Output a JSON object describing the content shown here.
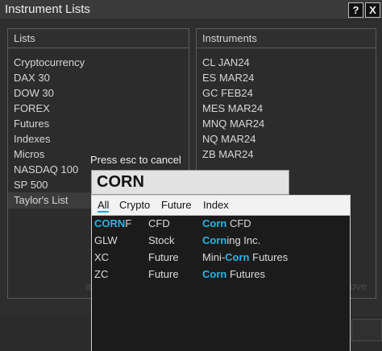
{
  "window": {
    "title": "Instrument Lists",
    "help_label": "?",
    "close_label": "X"
  },
  "lists_panel": {
    "header": "Lists",
    "items": [
      "Cryptocurrency",
      "DAX 30",
      "DOW 30",
      "FOREX",
      "Futures",
      "Indexes",
      "Micros",
      "NASDAQ 100",
      "SP 500",
      "Taylor's List"
    ],
    "selected_item": "Taylor's List"
  },
  "instruments_panel": {
    "header": "Instruments",
    "items": [
      "CL JAN24",
      "ES MAR24",
      "GC FEB24",
      "MES MAR24",
      "MNQ MAR24",
      "NQ MAR24",
      "ZB MAR24"
    ]
  },
  "background_fragments": {
    "left": "a",
    "right": "ove"
  },
  "search": {
    "prompt": "Press esc to cancel",
    "value": "CORN"
  },
  "filter_tabs": [
    {
      "label": "All",
      "active": true
    },
    {
      "label": "Crypto",
      "active": false
    },
    {
      "label": "Future",
      "active": false
    },
    {
      "label": "Index",
      "active": false
    }
  ],
  "results": [
    {
      "symbol_match": "CORN",
      "symbol_rest": "F",
      "type": "CFD",
      "desc_pre": "",
      "desc_match": "Corn",
      "desc_post": " CFD"
    },
    {
      "symbol_match": "",
      "symbol_rest": "GLW",
      "type": "Stock",
      "desc_pre": "",
      "desc_match": "Corn",
      "desc_post": "ing Inc."
    },
    {
      "symbol_match": "",
      "symbol_rest": "XC",
      "type": "Future",
      "desc_pre": "Mini-",
      "desc_match": "Corn",
      "desc_post": " Futures"
    },
    {
      "symbol_match": "",
      "symbol_rest": "ZC",
      "type": "Future",
      "desc_pre": "",
      "desc_match": "Corn",
      "desc_post": " Futures"
    }
  ],
  "colors": {
    "highlight": "#27b5e4",
    "background": "#2e2e2e"
  }
}
